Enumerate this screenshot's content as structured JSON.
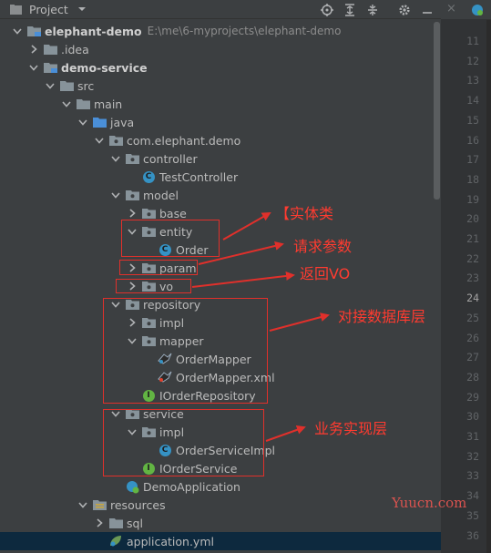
{
  "toolbar": {
    "title": "Project"
  },
  "editor": {
    "line_numbers": [
      "11",
      "12",
      "13",
      "14",
      "15",
      "16",
      "17",
      "18",
      "19",
      "20",
      "21",
      "22",
      "23",
      "24",
      "25",
      "26",
      "27",
      "28",
      "29",
      "30",
      "31",
      "32",
      "33",
      "34",
      "35",
      "36"
    ],
    "current_line": "24"
  },
  "tree": [
    {
      "label": "elephant-demo",
      "path": "E:\\me\\6-myprojects\\elephant-demo",
      "depth": 0,
      "arrow": "down",
      "icon": "module-folder",
      "bold": true
    },
    {
      "label": ".idea",
      "depth": 1,
      "arrow": "right",
      "icon": "folder"
    },
    {
      "label": "demo-service",
      "depth": 1,
      "arrow": "down",
      "icon": "module-folder",
      "bold": true
    },
    {
      "label": "src",
      "depth": 2,
      "arrow": "down",
      "icon": "folder"
    },
    {
      "label": "main",
      "depth": 3,
      "arrow": "down",
      "icon": "folder"
    },
    {
      "label": "java",
      "depth": 4,
      "arrow": "down",
      "icon": "source-folder"
    },
    {
      "label": "com.elephant.demo",
      "depth": 5,
      "arrow": "down",
      "icon": "package"
    },
    {
      "label": "controller",
      "depth": 6,
      "arrow": "down",
      "icon": "package"
    },
    {
      "label": "TestController",
      "depth": 7,
      "arrow": "none",
      "icon": "class"
    },
    {
      "label": "model",
      "depth": 6,
      "arrow": "down",
      "icon": "package"
    },
    {
      "label": "base",
      "depth": 7,
      "arrow": "right",
      "icon": "package"
    },
    {
      "label": "entity",
      "depth": 7,
      "arrow": "down",
      "icon": "package"
    },
    {
      "label": "Order",
      "depth": 8,
      "arrow": "none",
      "icon": "class"
    },
    {
      "label": "param",
      "depth": 7,
      "arrow": "right",
      "icon": "package"
    },
    {
      "label": "vo",
      "depth": 7,
      "arrow": "right",
      "icon": "package"
    },
    {
      "label": "repository",
      "depth": 6,
      "arrow": "down",
      "icon": "package"
    },
    {
      "label": "impl",
      "depth": 7,
      "arrow": "right",
      "icon": "package"
    },
    {
      "label": "mapper",
      "depth": 7,
      "arrow": "down",
      "icon": "package"
    },
    {
      "label": "OrderMapper",
      "depth": 8,
      "arrow": "none",
      "icon": "mybatis"
    },
    {
      "label": "OrderMapper.xml",
      "depth": 8,
      "arrow": "none",
      "icon": "mybatis-xml"
    },
    {
      "label": "IOrderRepository",
      "depth": 7,
      "arrow": "none",
      "icon": "interface"
    },
    {
      "label": "service",
      "depth": 6,
      "arrow": "down",
      "icon": "package"
    },
    {
      "label": "impl",
      "depth": 7,
      "arrow": "down",
      "icon": "package"
    },
    {
      "label": "OrderServiceImpl",
      "depth": 8,
      "arrow": "none",
      "icon": "class"
    },
    {
      "label": "IOrderService",
      "depth": 7,
      "arrow": "none",
      "icon": "interface"
    },
    {
      "label": "DemoApplication",
      "depth": 6,
      "arrow": "none",
      "icon": "spring-class"
    },
    {
      "label": "resources",
      "depth": 4,
      "arrow": "down",
      "icon": "resources-folder"
    },
    {
      "label": "sql",
      "depth": 5,
      "arrow": "right",
      "icon": "folder"
    },
    {
      "label": "application.yml",
      "depth": 5,
      "arrow": "none",
      "icon": "yml",
      "selected": true
    }
  ],
  "annotations": {
    "entity": "【实体类",
    "param": "请求参数",
    "vo": "返回VO",
    "repository": "对接数据库层",
    "service": "业务实现层"
  },
  "watermark": "Yuucn.com",
  "colors": {
    "annotation": "#e0302b",
    "selection": "#0d293e"
  }
}
